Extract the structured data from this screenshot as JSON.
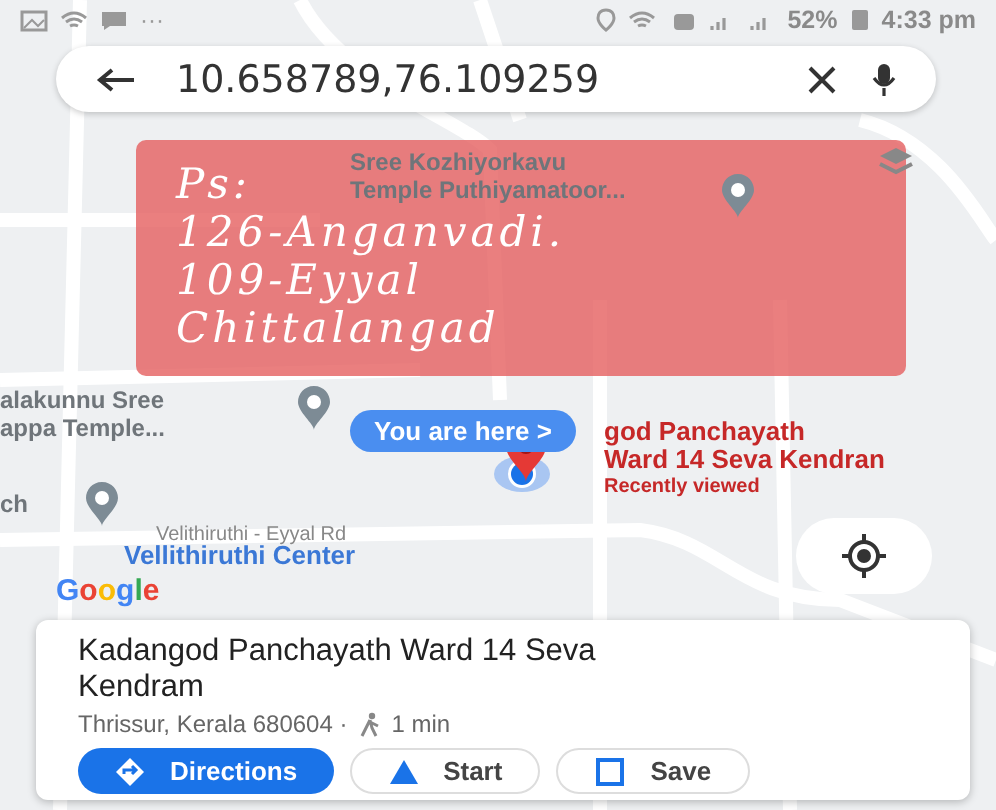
{
  "status_bar": {
    "more": "···",
    "battery": "52%",
    "time": "4:33 pm"
  },
  "search": {
    "value": "10.658789,76.109259"
  },
  "map": {
    "places": [
      {
        "kind": "grey",
        "lines": [
          "Sree Kozhiyorkavu",
          "Temple Puthiyamatoor..."
        ]
      },
      {
        "kind": "grey",
        "lines": [
          "alakunnu Sree",
          "appa Temple..."
        ]
      },
      {
        "kind": "grey",
        "lines": [
          "ch"
        ]
      },
      {
        "kind": "road",
        "lines": [
          "Velithiruthi - Eyyal Rd"
        ]
      },
      {
        "kind": "blue",
        "lines": [
          "Vellithiruthi Center"
        ]
      },
      {
        "kind": "red",
        "lines": [
          "god Panchayath",
          "Ward 14 Seva Kendran"
        ]
      }
    ],
    "selected_caption": "Recently viewed",
    "you_are_here": {
      "text": "You are here",
      "arrow": ">"
    },
    "logo": "Google"
  },
  "note": {
    "lines": [
      "Ps:",
      "126-Anganvadi.",
      "109-Eyyal",
      "Chittalangad"
    ]
  },
  "card": {
    "title": "Kadangod Panchayath Ward 14 Seva Kendram",
    "address": "Thrissur, Kerala 680604 ·",
    "walk": "1 min",
    "buttons": [
      {
        "label": "Directions",
        "kind": "primary"
      },
      {
        "label": "Start",
        "kind": "outline"
      },
      {
        "label": "Save",
        "kind": "outline"
      }
    ]
  }
}
